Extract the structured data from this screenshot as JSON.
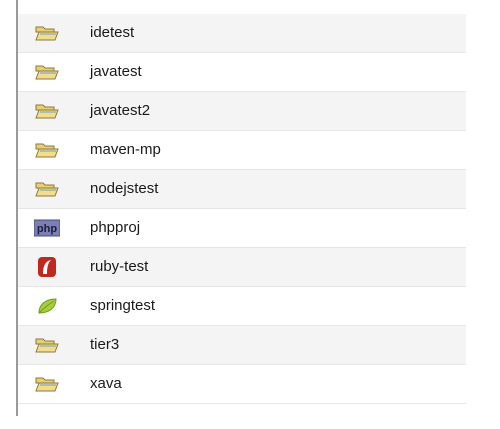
{
  "projects": [
    {
      "label": "idetest",
      "icon": "folder-icon"
    },
    {
      "label": "javatest",
      "icon": "folder-icon"
    },
    {
      "label": "javatest2",
      "icon": "folder-icon"
    },
    {
      "label": "maven-mp",
      "icon": "folder-icon"
    },
    {
      "label": "nodejstest",
      "icon": "folder-icon"
    },
    {
      "label": "phpproj",
      "icon": "php-icon"
    },
    {
      "label": "ruby-test",
      "icon": "ruby-icon"
    },
    {
      "label": "springtest",
      "icon": "spring-leaf-icon"
    },
    {
      "label": "tier3",
      "icon": "folder-icon"
    },
    {
      "label": "xava",
      "icon": "folder-icon"
    }
  ],
  "icon_text": {
    "php": "php"
  },
  "colors": {
    "folder_fill": "#f3dc8c",
    "folder_stroke": "#8a7a3c",
    "php_bg": "#7b7fb5",
    "ruby_red": "#c1281e",
    "spring_green": "#8bbf2a",
    "row_alt": "#f4f4f4"
  }
}
